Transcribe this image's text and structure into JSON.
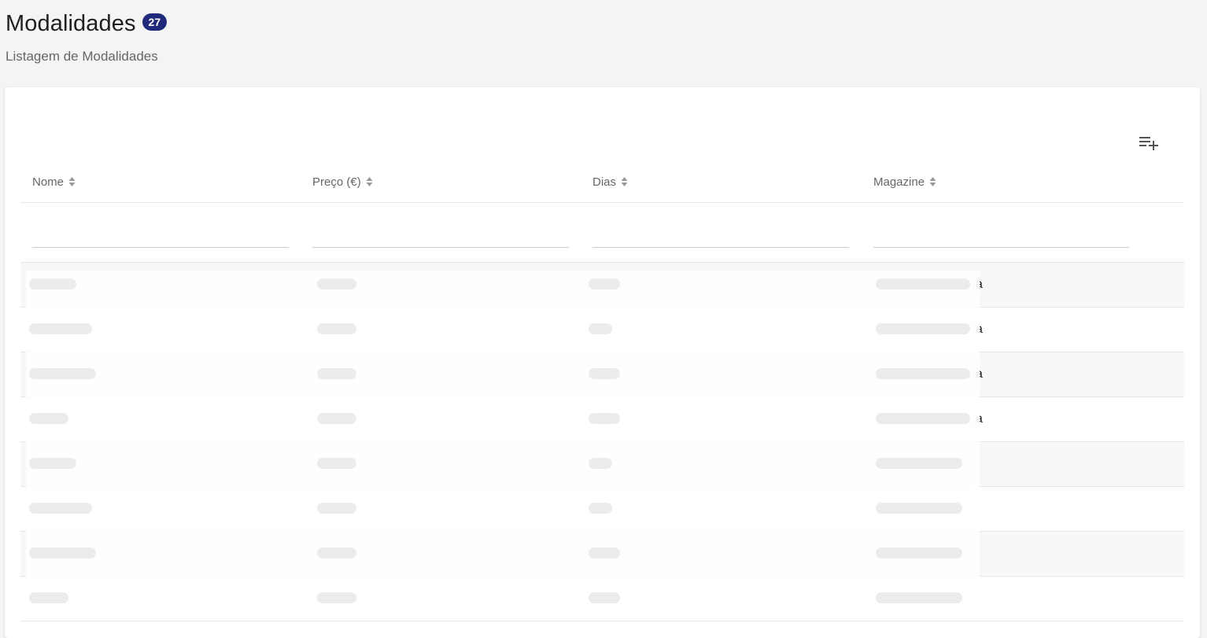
{
  "header": {
    "title": "Modalidades",
    "count": "27",
    "subtitle": "Listagem de Modalidades"
  },
  "toolbar": {
    "add_icon": "playlist-add-icon"
  },
  "table": {
    "columns": [
      "Nome",
      "Preço (€)",
      "Dias",
      "Magazine"
    ],
    "filters": [
      "",
      "",
      "",
      ""
    ],
    "rows": [
      [
        "",
        "",
        "",
        "a"
      ],
      [
        "",
        "",
        "",
        "a"
      ],
      [
        "",
        "",
        "",
        "a"
      ],
      [
        "",
        "",
        "",
        "a"
      ],
      [
        "",
        "",
        "",
        ""
      ],
      [
        "",
        "",
        "",
        ""
      ],
      [
        "",
        "",
        "",
        ""
      ],
      [
        "",
        "",
        "",
        ""
      ]
    ]
  },
  "colors": {
    "accent_badge": "#1f2a7a",
    "background": "#f4f4f4"
  }
}
